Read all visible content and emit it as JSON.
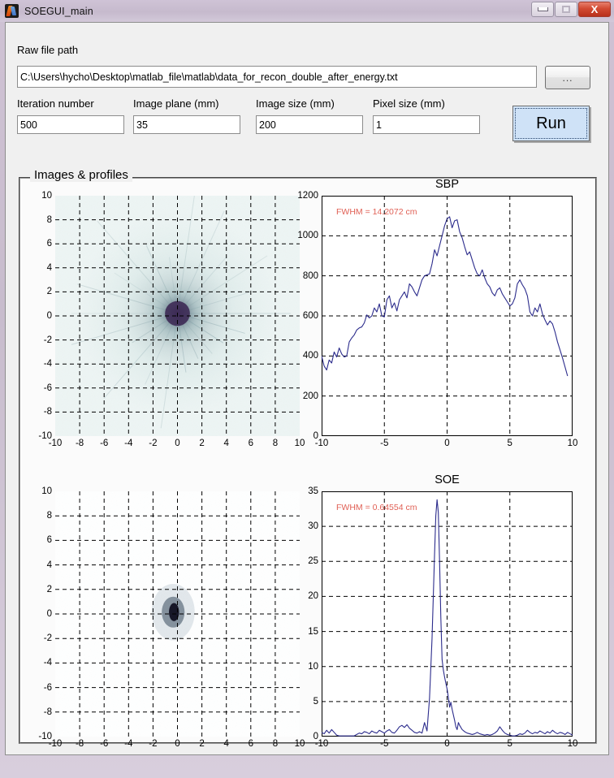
{
  "window": {
    "title": "SOEGUI_main",
    "icon": "matlab-icon",
    "controls": {
      "minimize": "minimize-icon",
      "maximize": "maximize-icon",
      "close": "X"
    }
  },
  "form": {
    "raw_file_path_label": "Raw file path",
    "raw_file_path_value": "C:\\Users\\hycho\\Desktop\\matlab_file\\matlab\\data_for_recon_double_after_energy.txt",
    "browse_label": "...",
    "run_label": "Run",
    "fields": [
      {
        "label": "Iteration number",
        "value": "500"
      },
      {
        "label": "Image plane (mm)",
        "value": "35"
      },
      {
        "label": "Image size (mm)",
        "value": "200"
      },
      {
        "label": "Pixel size (mm)",
        "value": "1"
      }
    ]
  },
  "panel": {
    "title": "Images & profiles"
  },
  "colors": {
    "line": "#2c2c8c",
    "annotation": "#e06055",
    "run_button": "#cfe2f7",
    "grid": "#000000"
  },
  "chart_data": [
    {
      "id": "sbp-image",
      "type": "heatmap",
      "title": "",
      "xlabel": "",
      "ylabel": "",
      "xlim": [
        -10,
        10
      ],
      "ylim": [
        -10,
        10
      ],
      "xticks": [
        -10,
        -8,
        -6,
        -4,
        -2,
        0,
        2,
        4,
        6,
        8,
        10
      ],
      "yticks": [
        -10,
        -8,
        -6,
        -4,
        -2,
        0,
        2,
        4,
        6,
        8,
        10
      ],
      "grid": true,
      "description": "Noisy pale cyan back-projection field with dark purple star-shaped hotspot at origin",
      "hotspot": {
        "x": 0,
        "y": 0.2,
        "radius": 1.2,
        "peak_color": "#3d2a55"
      },
      "background_color": "#eef5f4"
    },
    {
      "id": "sbp-profile",
      "type": "line",
      "title": "SBP",
      "xlabel": "",
      "ylabel": "",
      "xlim": [
        -10,
        10
      ],
      "ylim": [
        0,
        1200
      ],
      "xticks": [
        -10,
        -5,
        0,
        5,
        10
      ],
      "yticks": [
        0,
        200,
        400,
        600,
        800,
        1000,
        1200
      ],
      "grid": true,
      "annotation": "FWHM = 14.2072 cm",
      "series": [
        {
          "name": "SBP profile",
          "color": "#2c2c8c",
          "x": [
            -10.0,
            -9.8,
            -9.6,
            -9.4,
            -9.2,
            -9.0,
            -8.8,
            -8.6,
            -8.4,
            -8.2,
            -8.0,
            -7.8,
            -7.6,
            -7.4,
            -7.2,
            -7.0,
            -6.8,
            -6.6,
            -6.4,
            -6.2,
            -6.0,
            -5.8,
            -5.6,
            -5.4,
            -5.2,
            -5.0,
            -4.8,
            -4.6,
            -4.4,
            -4.2,
            -4.0,
            -3.8,
            -3.6,
            -3.4,
            -3.2,
            -3.0,
            -2.8,
            -2.6,
            -2.4,
            -2.2,
            -2.0,
            -1.8,
            -1.6,
            -1.4,
            -1.2,
            -1.0,
            -0.8,
            -0.6,
            -0.4,
            -0.2,
            0.0,
            0.2,
            0.4,
            0.6,
            0.8,
            1.0,
            1.2,
            1.4,
            1.6,
            1.8,
            2.0,
            2.2,
            2.4,
            2.6,
            2.8,
            3.0,
            3.2,
            3.4,
            3.6,
            3.8,
            4.0,
            4.2,
            4.4,
            4.6,
            4.8,
            5.0,
            5.2,
            5.4,
            5.6,
            5.8,
            6.0,
            6.2,
            6.4,
            6.6,
            6.8,
            7.0,
            7.2,
            7.4,
            7.6,
            7.8,
            8.0,
            8.2,
            8.4,
            8.6,
            8.8,
            9.0,
            9.2,
            9.4,
            9.6,
            9.8,
            10.0
          ],
          "y": [
            400,
            350,
            330,
            380,
            365,
            420,
            395,
            440,
            410,
            395,
            400,
            470,
            490,
            505,
            530,
            540,
            545,
            565,
            605,
            590,
            600,
            640,
            620,
            660,
            600,
            595,
            680,
            700,
            640,
            665,
            625,
            680,
            700,
            720,
            690,
            760,
            745,
            720,
            700,
            740,
            780,
            800,
            805,
            810,
            860,
            930,
            900,
            950,
            1000,
            1050,
            1085,
            1095,
            1040,
            1075,
            1080,
            1020,
            990,
            945,
            905,
            920,
            880,
            840,
            810,
            800,
            830,
            790,
            760,
            745,
            715,
            700,
            730,
            740,
            710,
            690,
            670,
            650,
            660,
            690,
            760,
            780,
            755,
            735,
            700,
            620,
            600,
            640,
            620,
            660,
            610,
            580,
            555,
            575,
            560,
            520,
            470,
            430,
            390,
            345,
            300
          ]
        }
      ]
    },
    {
      "id": "soe-image",
      "type": "heatmap",
      "title": "",
      "xlabel": "",
      "ylabel": "",
      "xlim": [
        -10,
        10
      ],
      "ylim": [
        -10,
        10
      ],
      "xticks": [
        -10,
        -8,
        -6,
        -4,
        -2,
        0,
        2,
        4,
        6,
        8,
        10
      ],
      "yticks": [
        -10,
        -8,
        -6,
        -4,
        -2,
        0,
        2,
        4,
        6,
        8,
        10
      ],
      "grid": true,
      "description": "Mostly white reconstructed image with a small compact dark blob just left of centre near y = 0",
      "hotspot": {
        "x": -0.35,
        "y": 0.15,
        "radius": 0.55,
        "peak_color": "#111122"
      },
      "background_color": "#ffffff"
    },
    {
      "id": "soe-profile",
      "type": "line",
      "title": "SOE",
      "xlabel": "",
      "ylabel": "",
      "xlim": [
        -10,
        10
      ],
      "ylim": [
        0,
        35
      ],
      "xticks": [
        -10,
        -5,
        0,
        5,
        10
      ],
      "yticks": [
        0,
        5,
        10,
        15,
        20,
        25,
        30,
        35
      ],
      "grid": true,
      "annotation": "FWHM = 0.64554 cm",
      "series": [
        {
          "name": "SOE profile",
          "color": "#2c2c8c",
          "x": [
            -10.0,
            -9.8,
            -9.6,
            -9.4,
            -9.2,
            -9.0,
            -8.8,
            -8.6,
            -8.4,
            -8.2,
            -8.0,
            -7.8,
            -7.6,
            -7.4,
            -7.2,
            -7.0,
            -6.8,
            -6.6,
            -6.4,
            -6.2,
            -6.0,
            -5.8,
            -5.6,
            -5.4,
            -5.2,
            -5.0,
            -4.8,
            -4.6,
            -4.4,
            -4.2,
            -4.0,
            -3.8,
            -3.6,
            -3.4,
            -3.2,
            -3.0,
            -2.8,
            -2.6,
            -2.4,
            -2.2,
            -2.0,
            -1.8,
            -1.6,
            -1.4,
            -1.2,
            -1.0,
            -0.9,
            -0.8,
            -0.7,
            -0.6,
            -0.5,
            -0.4,
            -0.3,
            -0.2,
            -0.1,
            0.0,
            0.1,
            0.2,
            0.3,
            0.4,
            0.5,
            0.6,
            0.7,
            0.8,
            0.9,
            1.0,
            1.2,
            1.4,
            1.6,
            1.8,
            2.0,
            2.2,
            2.4,
            2.6,
            2.8,
            3.0,
            3.2,
            3.4,
            3.6,
            3.8,
            4.0,
            4.2,
            4.4,
            4.6,
            4.8,
            5.0,
            5.2,
            5.4,
            5.6,
            5.8,
            6.0,
            6.2,
            6.4,
            6.6,
            6.8,
            7.0,
            7.2,
            7.4,
            7.6,
            7.8,
            8.0,
            8.2,
            8.4,
            8.6,
            8.8,
            9.0,
            9.2,
            9.4,
            9.6,
            9.8,
            10.0
          ],
          "y": [
            0.6,
            0.4,
            0.9,
            0.5,
            1.0,
            0.6,
            0.2,
            0.1,
            0.1,
            0.1,
            0.1,
            0.1,
            0.1,
            0.1,
            0.3,
            0.5,
            0.4,
            0.7,
            0.6,
            0.4,
            0.8,
            0.6,
            0.5,
            0.9,
            0.7,
            0.5,
            0.8,
            1.0,
            0.6,
            0.5,
            0.9,
            1.4,
            1.6,
            1.3,
            1.7,
            1.2,
            0.9,
            0.6,
            0.5,
            0.7,
            0.5,
            2.0,
            0.8,
            5.5,
            14.0,
            26.0,
            31.5,
            33.8,
            32.0,
            25.0,
            17.0,
            11.0,
            9.5,
            8.5,
            7.6,
            6.8,
            5.6,
            4.2,
            4.9,
            3.9,
            3.1,
            2.3,
            1.4,
            1.0,
            2.0,
            1.6,
            1.0,
            0.7,
            0.5,
            0.4,
            0.3,
            0.4,
            0.6,
            0.4,
            0.3,
            0.2,
            0.3,
            0.2,
            0.3,
            0.5,
            0.8,
            1.4,
            0.9,
            0.5,
            0.3,
            0.2,
            0.1,
            0.1,
            0.2,
            0.4,
            0.3,
            0.5,
            0.9,
            0.6,
            0.4,
            0.6,
            0.5,
            0.8,
            0.6,
            0.4,
            0.7,
            0.5,
            0.9,
            0.6,
            0.4,
            0.6,
            0.5,
            0.3,
            0.6,
            0.4,
            0.2
          ]
        }
      ]
    }
  ]
}
